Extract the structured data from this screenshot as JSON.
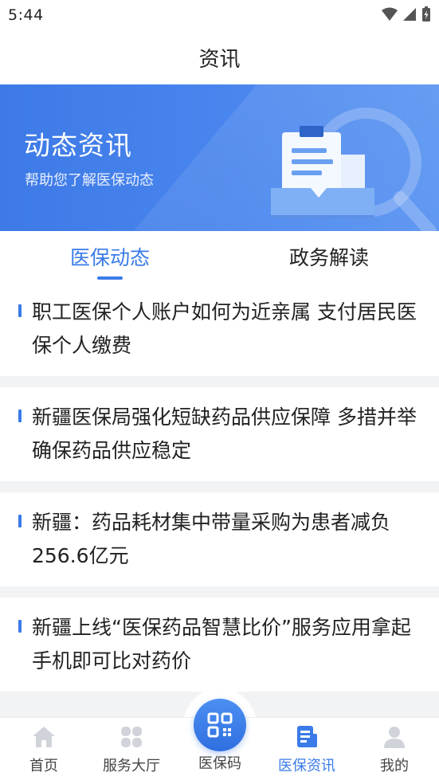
{
  "status_bar": {
    "time": "5:44"
  },
  "header": {
    "title": "资讯"
  },
  "banner": {
    "title": "动态资讯",
    "subtitle": "帮助您了解医保动态"
  },
  "tabs": [
    {
      "label": "医保动态",
      "active": true
    },
    {
      "label": "政务解读",
      "active": false
    }
  ],
  "news": [
    {
      "title": "职工医保个人账户如何为近亲属 支付居民医保个人缴费"
    },
    {
      "title": "新疆医保局强化短缺药品供应保障 多措并举确保药品供应稳定"
    },
    {
      "title": "新疆：药品耗材集中带量采购为患者减负256.6亿元"
    },
    {
      "title": "新疆上线“医保药品智慧比价”服务应用拿起手机即可比对药价"
    }
  ],
  "tabbar": {
    "items": [
      {
        "label": "首页",
        "icon": "home-icon"
      },
      {
        "label": "服务大厅",
        "icon": "grid-icon"
      },
      {
        "label": "医保码",
        "icon": "qr-code-icon"
      },
      {
        "label": "医保资讯",
        "icon": "news-icon",
        "active": true
      },
      {
        "label": "我的",
        "icon": "user-icon"
      }
    ]
  },
  "colors": {
    "accent": "#3a7be9",
    "text": "#222222",
    "inactive_icon": "#d0d4da"
  }
}
